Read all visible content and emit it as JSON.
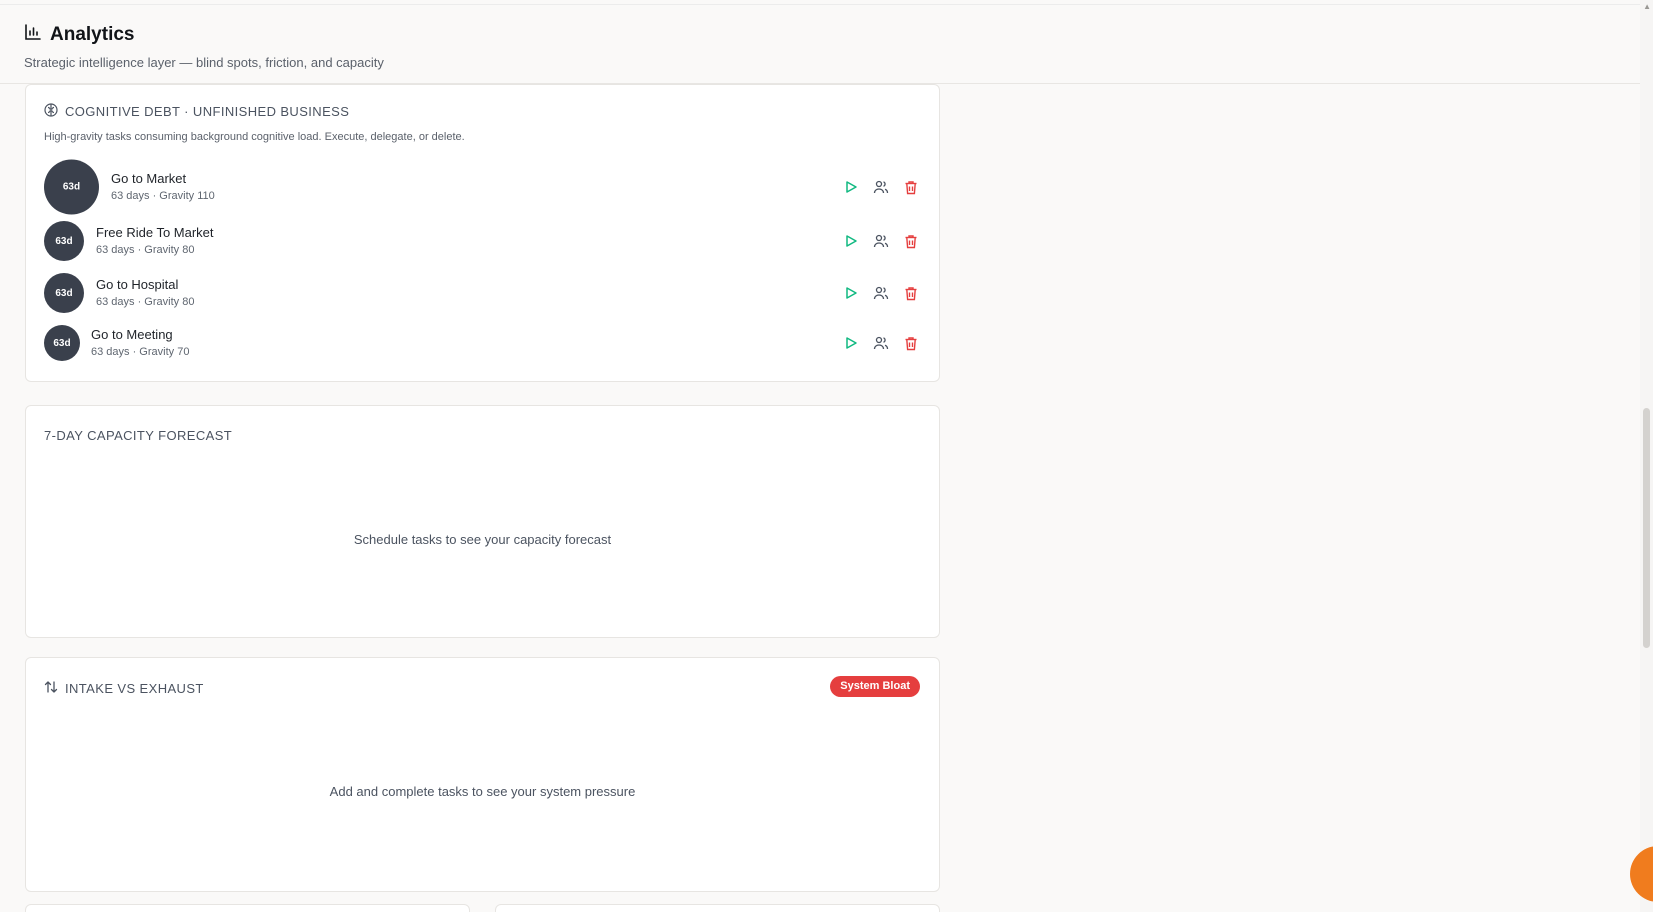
{
  "header": {
    "title": "Analytics",
    "subtitle": "Strategic intelligence layer — blind spots, friction, and capacity"
  },
  "cognitive_debt": {
    "title": "COGNITIVE DEBT · UNFINISHED BUSINESS",
    "description": "High-gravity tasks consuming background cognitive load. Execute, delegate, or delete.",
    "tasks": [
      {
        "age": "63d",
        "name": "Go to Market",
        "meta": "63 days · Gravity 110"
      },
      {
        "age": "63d",
        "name": "Free Ride To Market",
        "meta": "63 days · Gravity 80"
      },
      {
        "age": "63d",
        "name": "Go to Hospital",
        "meta": "63 days · Gravity 80"
      },
      {
        "age": "63d",
        "name": "Go to Meeting",
        "meta": "63 days · Gravity 70"
      }
    ]
  },
  "capacity_forecast": {
    "title": "7-DAY CAPACITY FORECAST",
    "empty_text": "Schedule tasks to see your capacity forecast"
  },
  "intake_exhaust": {
    "title": "INTAKE VS EXHAUST",
    "badge": "System Bloat",
    "empty_text": "Add and complete tasks to see your system pressure"
  },
  "colors": {
    "accent_orange": "#f07c1e",
    "play_green": "#10b981",
    "delete_red": "#e53e3e",
    "avatar_dark": "#3a404c"
  },
  "icons": {
    "header": "bar-chart-icon",
    "cognitive_debt": "brain-icon",
    "intake_exhaust": "arrows-up-down-icon",
    "row_actions": [
      "play-icon",
      "users-icon",
      "trash-icon"
    ]
  }
}
